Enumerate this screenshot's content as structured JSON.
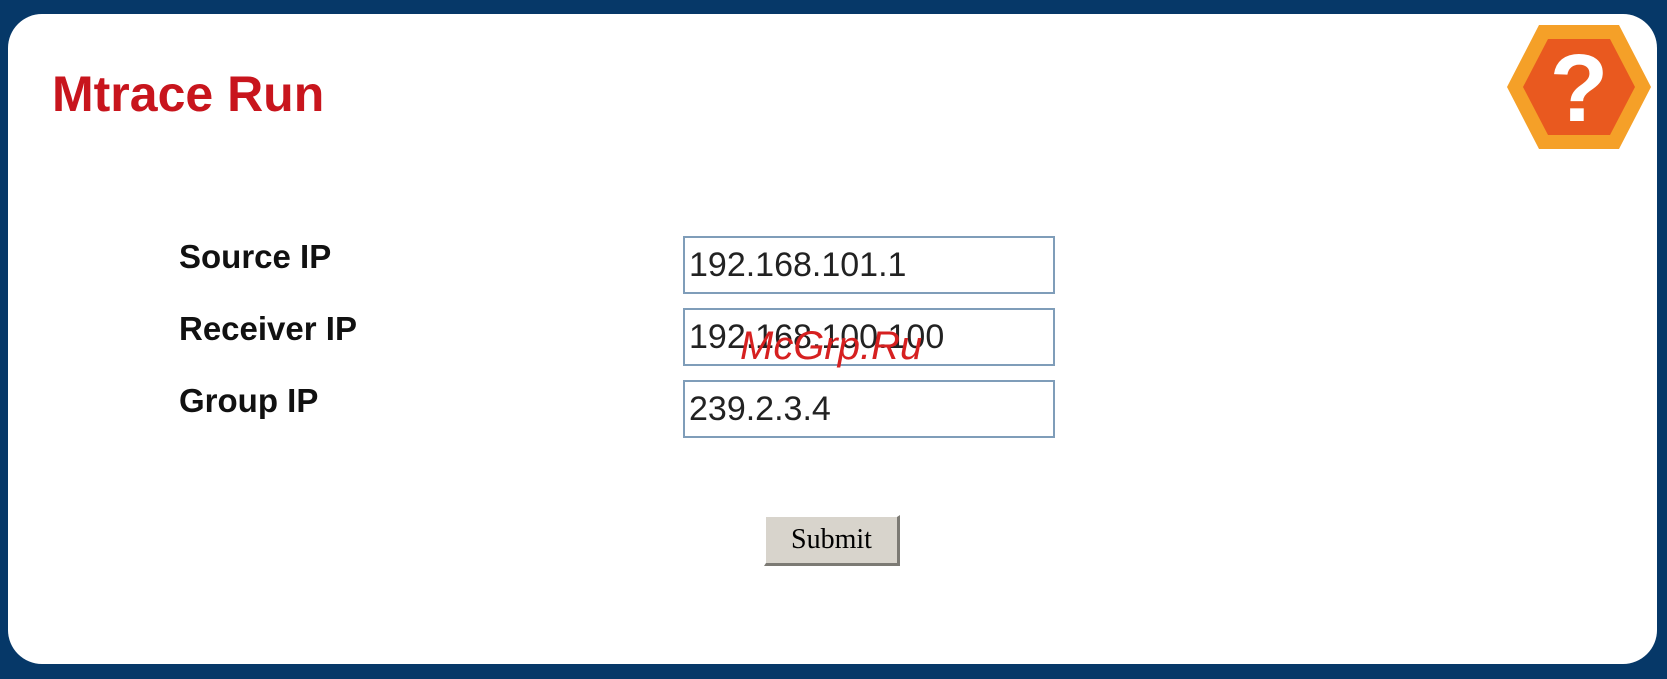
{
  "page": {
    "title": "Mtrace Run"
  },
  "help": {
    "icon": "question-mark-hexagon-icon",
    "glyph": "?",
    "colors": {
      "outer": "#f5a028",
      "inner": "#e9591f",
      "glyph": "#ffffff"
    }
  },
  "form": {
    "source_ip": {
      "label": "Source IP",
      "value": "192.168.101.1"
    },
    "receiver_ip": {
      "label": "Receiver IP",
      "value": "192.168.100.100"
    },
    "group_ip": {
      "label": "Group IP",
      "value": "239.2.3.4"
    },
    "submit_label": "Submit"
  },
  "watermark": {
    "text": "McGrp.Ru"
  },
  "colors": {
    "frame": "#063868",
    "title": "#c8151d",
    "input_border": "#7f9db9",
    "button_face": "#d8d4cc",
    "watermark": "#d62020"
  }
}
